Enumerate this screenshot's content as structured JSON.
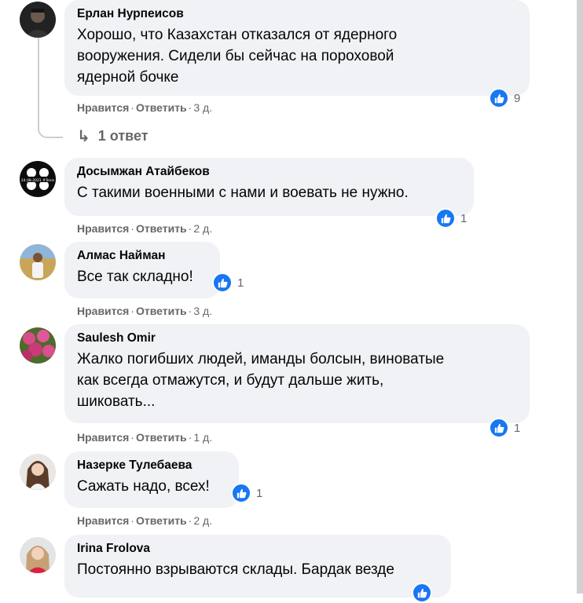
{
  "comments": [
    {
      "author": "Ерлан Нурпеисов",
      "lines": [
        "Хорошо, что Казахстан отказался от ядерного",
        "вооружения. Сидели бы сейчас на пороховой",
        "ядерной бочке"
      ],
      "like": "Нравится",
      "reply": "Ответить",
      "time": "3 д.",
      "reactions": "9"
    },
    {
      "author": "Досымжан Атайбеков",
      "lines": [
        "С такими военными с нами и воевать не нужно."
      ],
      "like": "Нравится",
      "reply": "Ответить",
      "time": "2 д.",
      "reactions": "1",
      "avatar_text": "24.08.2021 #Tenis"
    },
    {
      "author": "Алмас Найман",
      "lines": [
        "Все так складно!"
      ],
      "like": "Нравится",
      "reply": "Ответить",
      "time": "3 д.",
      "reactions": "1"
    },
    {
      "author": "Saulesh Omir",
      "lines": [
        "Жалко погибших людей, иманды болсын, виноватые",
        "как всегда отмажутся, и будут дальше жить,",
        "шиковать..."
      ],
      "like": "Нравится",
      "reply": "Ответить",
      "time": "1 д.",
      "reactions": "1"
    },
    {
      "author": "Назерке Тулебаева",
      "lines": [
        "Сажать надо, всех!"
      ],
      "like": "Нравится",
      "reply": "Ответить",
      "time": "2 д.",
      "reactions": "1"
    },
    {
      "author": "Irina Frolova",
      "lines": [
        "Постоянно взрываются склады. Бардак везде"
      ]
    }
  ],
  "replies_link": "1 ответ",
  "separator": "·",
  "colors": {
    "bubble": "#f0f2f5",
    "like_blue": "#1877f2",
    "meta_gray": "#65676b"
  },
  "icons": {
    "like": "thumbs-up-icon",
    "reply_arrow": "reply-arrow-icon"
  }
}
